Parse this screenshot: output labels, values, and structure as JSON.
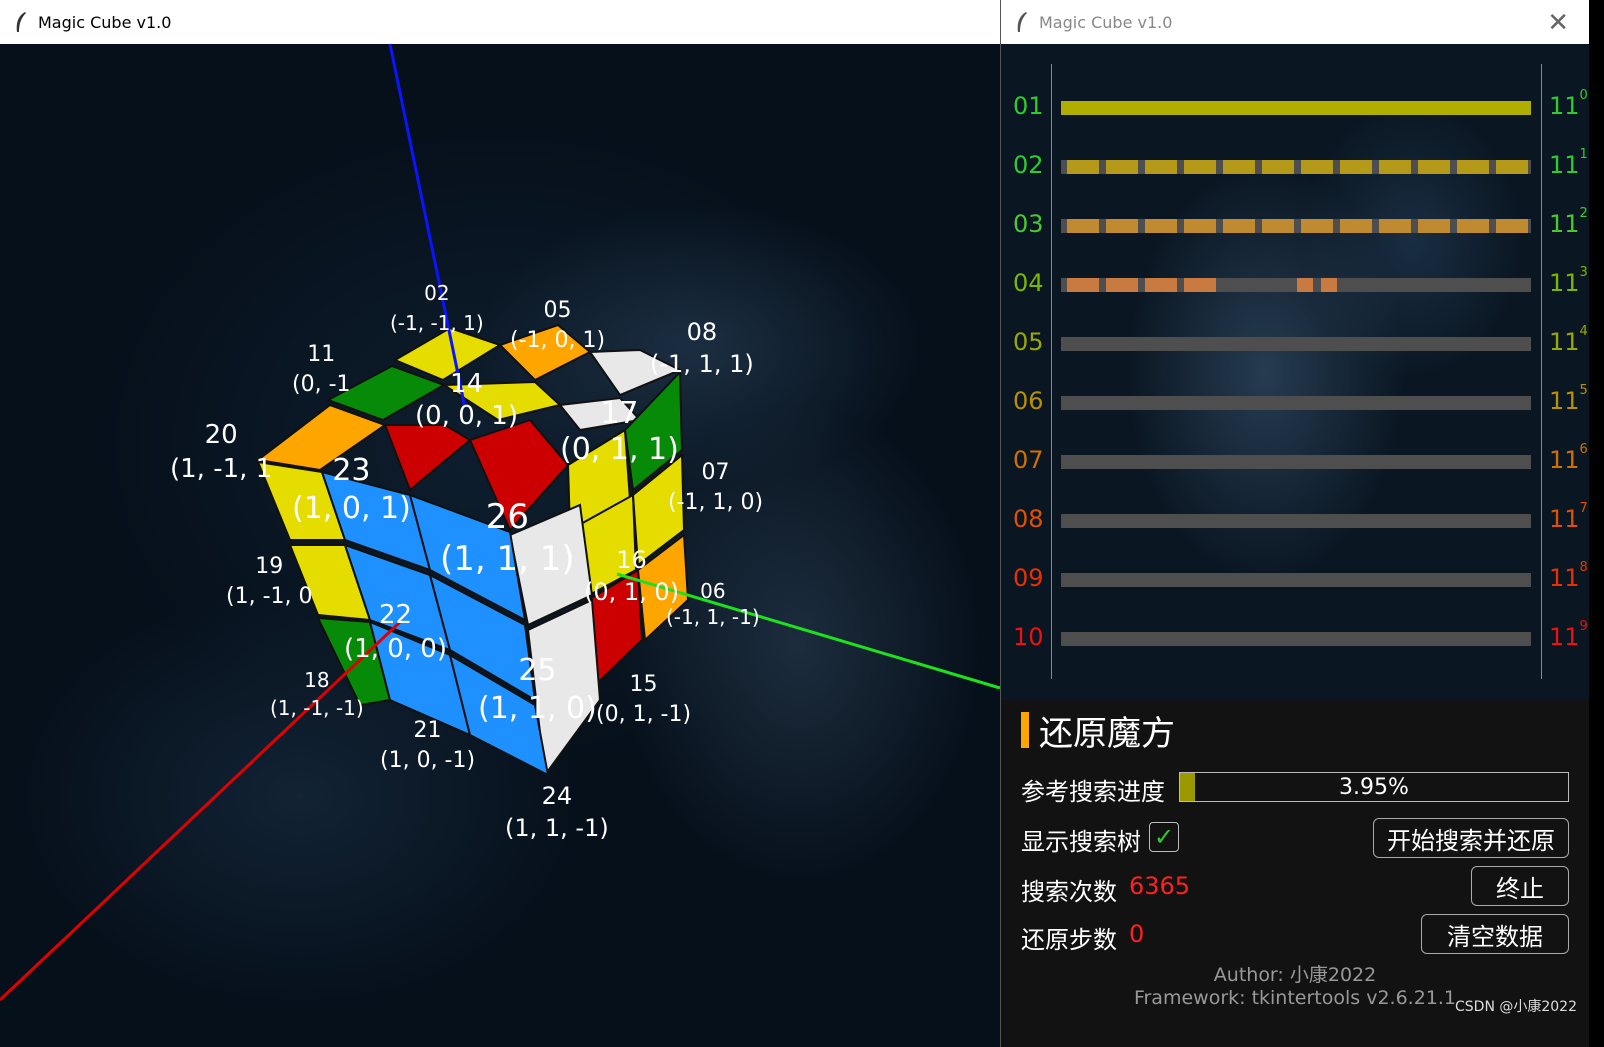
{
  "left_window": {
    "title": "Magic Cube v1.0",
    "cube_labels": [
      {
        "num": "02",
        "coord": "(-1, -1, 1)"
      },
      {
        "num": "05",
        "coord": "(-1, 0, 1)"
      },
      {
        "num": "08",
        "coord": "(-1, 1, 1)"
      },
      {
        "num": "11",
        "coord": "(0, -1"
      },
      {
        "num": "14",
        "coord": "(0, 0, 1)"
      },
      {
        "num": "17",
        "coord": "(0, 1, 1)"
      },
      {
        "num": "20",
        "coord": "(1, -1, 1"
      },
      {
        "num": "23",
        "coord": "(1, 0, 1)"
      },
      {
        "num": "26",
        "coord": "(1, 1, 1)"
      },
      {
        "num": "07",
        "coord": "(-1, 1, 0)"
      },
      {
        "num": "16",
        "coord": "(0, 1, 0)"
      },
      {
        "num": "19",
        "coord": "(1, -1, 0"
      },
      {
        "num": "22",
        "coord": "(1, 0, 0)"
      },
      {
        "num": "06",
        "coord": "(-1, 1, -1)"
      },
      {
        "num": "25",
        "coord": "(1, 1, 0)"
      },
      {
        "num": "18",
        "coord": "(1, -1, -1)"
      },
      {
        "num": "15",
        "coord": "(0, 1, -1)"
      },
      {
        "num": "21",
        "coord": "(1, 0, -1)"
      },
      {
        "num": "24",
        "coord": "(1, 1, -1)"
      }
    ],
    "colors": {
      "white": "#e8e8e8",
      "yellow": "#e5dc00",
      "orange": "#ffa500",
      "green": "#078a07",
      "red": "#cc0000",
      "blue": "#1e90ff"
    }
  },
  "right_window": {
    "title": "Magic Cube v1.0",
    "close_icon": "close-icon",
    "rows": [
      {
        "num": "01",
        "num_color": "#2ecc2e",
        "exp": "0",
        "exp_color": "#2ecc2e",
        "fill_pattern": "solid",
        "fill_color": "#b0ae00"
      },
      {
        "num": "02",
        "num_color": "#2ecc2e",
        "exp": "1",
        "exp_color": "#2ecc2e",
        "fill_pattern": "dashed-full",
        "fill_color": "#b59a1a"
      },
      {
        "num": "03",
        "num_color": "#4cc82e",
        "exp": "2",
        "exp_color": "#4cc82e",
        "fill_pattern": "dashed-full",
        "fill_color": "#c08a30"
      },
      {
        "num": "04",
        "num_color": "#7ab800",
        "exp": "3",
        "exp_color": "#7ab800",
        "fill_pattern": "dashed-partial",
        "fill_color": "#c87a40"
      },
      {
        "num": "05",
        "num_color": "#9aa800",
        "exp": "4",
        "exp_color": "#9aa800",
        "fill_pattern": "none",
        "fill_color": ""
      },
      {
        "num": "06",
        "num_color": "#b89000",
        "exp": "5",
        "exp_color": "#b89000",
        "fill_pattern": "none",
        "fill_color": ""
      },
      {
        "num": "07",
        "num_color": "#d07000",
        "exp": "6",
        "exp_color": "#d07000",
        "fill_pattern": "none",
        "fill_color": ""
      },
      {
        "num": "08",
        "num_color": "#e05000",
        "exp": "7",
        "exp_color": "#e05000",
        "fill_pattern": "none",
        "fill_color": ""
      },
      {
        "num": "09",
        "num_color": "#e83000",
        "exp": "8",
        "exp_color": "#e83000",
        "fill_pattern": "none",
        "fill_color": ""
      },
      {
        "num": "10",
        "num_color": "#f01010",
        "exp": "9",
        "exp_color": "#f01010",
        "fill_pattern": "none",
        "fill_color": ""
      }
    ],
    "base_label": "11",
    "panel": {
      "heading": "还原魔方",
      "progress_label": "参考搜索进度",
      "progress_text": "3.95%",
      "progress_value": 0.0395,
      "show_tree_label": "显示搜索树",
      "show_tree_checked": "✓",
      "start_button": "开始搜索并还原",
      "search_count_label": "搜索次数",
      "search_count": "6365",
      "stop_button": "终止",
      "steps_label": "还原步数",
      "steps": "0",
      "clear_button": "清空数据",
      "author": "Author: 小康2022",
      "framework": "Framework: tkintertools v2.6.21.1"
    }
  },
  "watermark": "CSDN @小康2022"
}
